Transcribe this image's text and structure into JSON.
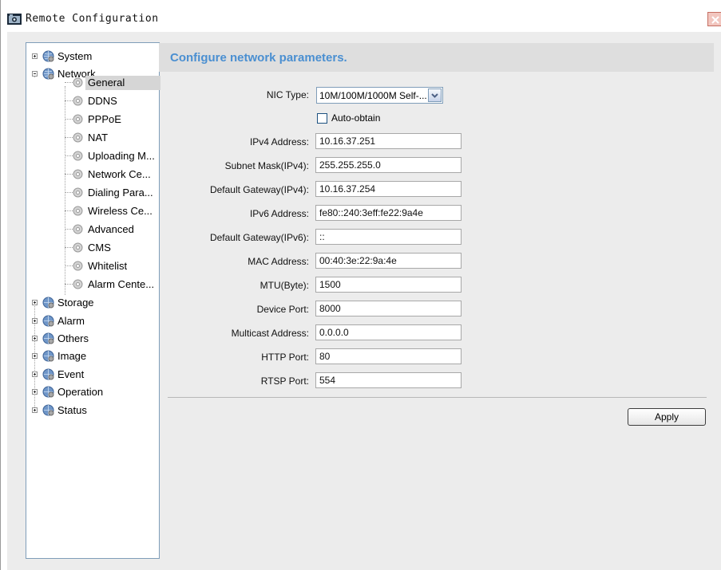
{
  "window": {
    "title": "Remote Configuration"
  },
  "header": {
    "title": "Configure network parameters."
  },
  "tree": {
    "top": [
      {
        "label": "System",
        "expanded": false
      },
      {
        "label": "Network",
        "expanded": true
      }
    ],
    "network_children": [
      "General",
      "DDNS",
      "PPPoE",
      "NAT",
      "Uploading M...",
      "Network Ce...",
      "Dialing Para...",
      "Wireless Ce...",
      "Advanced",
      "CMS",
      "Whitelist",
      "Alarm Cente..."
    ],
    "selected": "General",
    "bottom": [
      "Storage",
      "Alarm",
      "Others",
      "Image",
      "Event",
      "Operation",
      "Status"
    ]
  },
  "form": {
    "nic_type_label": "NIC Type:",
    "nic_type_value": "10M/100M/1000M Self-...",
    "auto_obtain_label": "Auto-obtain",
    "auto_obtain_checked": false,
    "fields": [
      {
        "label": "IPv4 Address:",
        "value": "10.16.37.251"
      },
      {
        "label": "Subnet Mask(IPv4):",
        "value": "255.255.255.0"
      },
      {
        "label": "Default Gateway(IPv4):",
        "value": "10.16.37.254"
      },
      {
        "label": "IPv6 Address:",
        "value": "fe80::240:3eff:fe22:9a4e"
      },
      {
        "label": "Default Gateway(IPv6):",
        "value": "::"
      },
      {
        "label": "MAC Address:",
        "value": "00:40:3e:22:9a:4e"
      },
      {
        "label": "MTU(Byte):",
        "value": "1500"
      },
      {
        "label": "Device Port:",
        "value": "8000"
      },
      {
        "label": "Multicast Address:",
        "value": "0.0.0.0"
      },
      {
        "label": "HTTP Port:",
        "value": "80"
      },
      {
        "label": "RTSP Port:",
        "value": "554"
      }
    ],
    "apply_label": "Apply"
  },
  "colors": {
    "header_title": "#4a8fd1",
    "header_strip": "#dedede",
    "client_bg": "#ececec",
    "selection": "#d6d6d6"
  },
  "icons": {
    "app": "camera-config-icon",
    "close": "close-icon",
    "group": "globe-gear-icon",
    "child": "gear-icon",
    "dropdown": "chevron-down-icon"
  }
}
